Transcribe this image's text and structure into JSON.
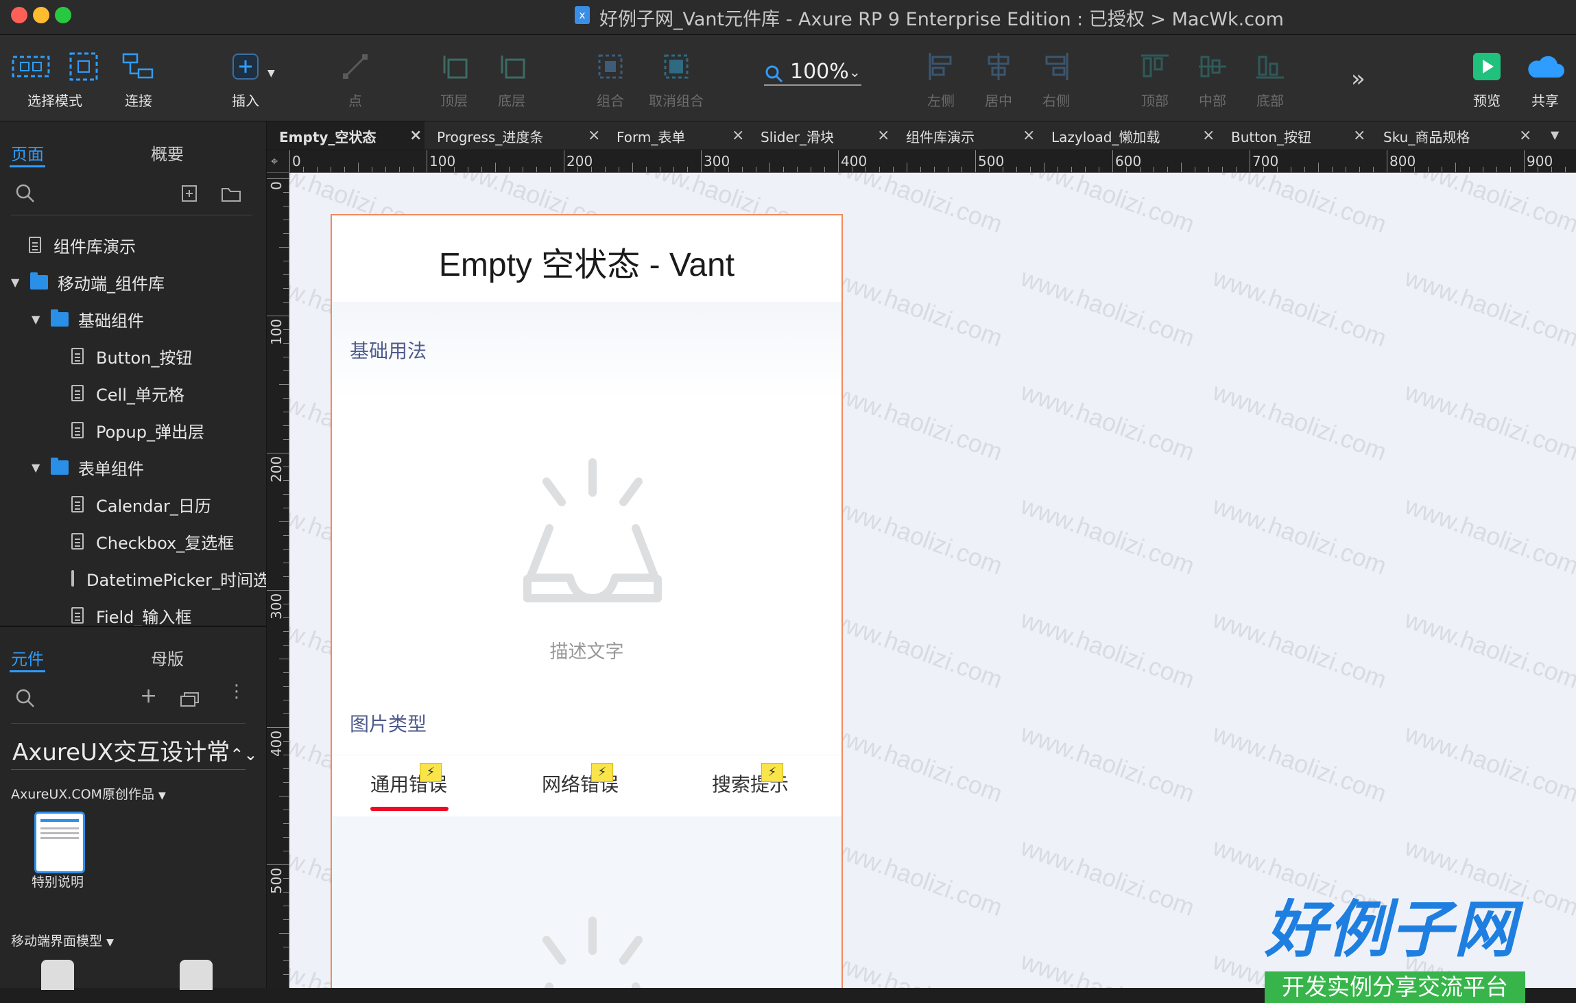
{
  "window": {
    "title": "好例子网_Vant元件库 - Axure RP 9 Enterprise Edition : 已授权 > MacWk.com",
    "app_icon": "axure-file-icon"
  },
  "toolbar": {
    "select_mode": "选择模式",
    "connect": "连接",
    "insert": "插入",
    "point": "点",
    "top_layer": "顶层",
    "bottom_layer": "底层",
    "group": "组合",
    "ungroup": "取消组合",
    "zoom": "100%",
    "align_left": "左侧",
    "align_center": "居中",
    "align_right": "右侧",
    "align_top": "顶部",
    "align_middle": "中部",
    "align_bottom": "底部",
    "preview": "预览",
    "share": "共享"
  },
  "pages_panel": {
    "tab_pages": "页面",
    "tab_outline": "概要",
    "items": [
      {
        "label": "组件库演示"
      },
      {
        "label": "移动端_组件库"
      },
      {
        "label": "基础组件"
      },
      {
        "label": "Button_按钮"
      },
      {
        "label": "Cell_单元格"
      },
      {
        "label": "Popup_弹出层"
      },
      {
        "label": "表单组件"
      },
      {
        "label": "Calendar_日历"
      },
      {
        "label": "Checkbox_复选框"
      },
      {
        "label": "DatetimePicker_时间选"
      },
      {
        "label": "Field_输入框"
      }
    ]
  },
  "widgets_panel": {
    "tab_widgets": "元件",
    "tab_masters": "母版",
    "library": "AxureUX交互设计常",
    "group_label": "AxureUX.COM原创作品",
    "widget_label": "特别说明",
    "group2_label": "移动端界面模型"
  },
  "doc_tabs": [
    {
      "label": "Empty_空状态"
    },
    {
      "label": "Progress_进度条"
    },
    {
      "label": "Form_表单"
    },
    {
      "label": "Slider_滑块"
    },
    {
      "label": "组件库演示"
    },
    {
      "label": "Lazyload_懒加载"
    },
    {
      "label": "Button_按钮"
    },
    {
      "label": "Sku_商品规格"
    }
  ],
  "ruler": {
    "h_labels": [
      "0",
      "100",
      "200",
      "300",
      "400",
      "500",
      "600",
      "700",
      "800",
      "900"
    ],
    "v_labels": [
      "0",
      "100",
      "200",
      "300",
      "400",
      "500"
    ]
  },
  "canvas": {
    "page_title": "Empty 空状态 - Vant",
    "section_basic": "基础用法",
    "empty_description": "描述文字",
    "section_image_type": "图片类型",
    "image_tabs": [
      "通用错误",
      "网络错误",
      "搜索提示"
    ],
    "active_tab_color": "#ee0a24",
    "watermark": "www.haolizi.com"
  },
  "logo": {
    "title": "好例子网",
    "subtitle": "开发实例分享交流平台"
  }
}
